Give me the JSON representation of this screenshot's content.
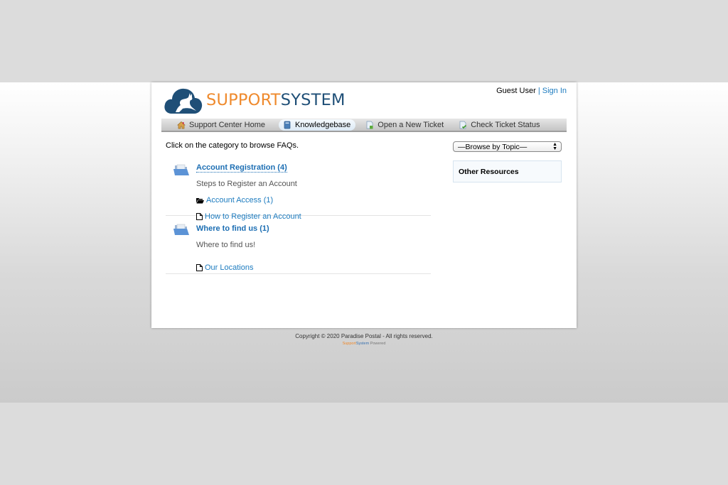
{
  "brand": {
    "logo_part1": "SUPPORT",
    "logo_part2": "SYSTEM",
    "colors": {
      "orange": "#ef8a2d",
      "navy": "#1f4f77",
      "link": "#1c7bbf"
    }
  },
  "user": {
    "name": "Guest User",
    "separator": "|",
    "sign_in": "Sign In"
  },
  "nav": {
    "items": [
      {
        "label": "Support Center Home",
        "icon": "home-icon"
      },
      {
        "label": "Knowledgebase",
        "icon": "book-icon",
        "active": true
      },
      {
        "label": "Open a New Ticket",
        "icon": "new-ticket-icon"
      },
      {
        "label": "Check Ticket Status",
        "icon": "ticket-status-icon"
      }
    ]
  },
  "main": {
    "intro": "Click on the category to browse FAQs.",
    "categories": [
      {
        "title": "Account Registration (4)",
        "description": "Steps to Register an Account",
        "subcategories": [
          "Account Access (1)"
        ],
        "articles": [
          "How to Register an Account"
        ]
      },
      {
        "title": "Where to find us (1)",
        "description": "Where to find us!",
        "subcategories": [],
        "articles": [
          "Our Locations"
        ]
      }
    ]
  },
  "sidebar": {
    "topic_select": "—Browse by Topic—",
    "resources_title": "Other Resources"
  },
  "footer": {
    "copyright": "Copyright © 2020 Paradise Postal - All rights reserved.",
    "powered_support": "Support",
    "powered_system": "System",
    "powered_label": "Powered"
  }
}
